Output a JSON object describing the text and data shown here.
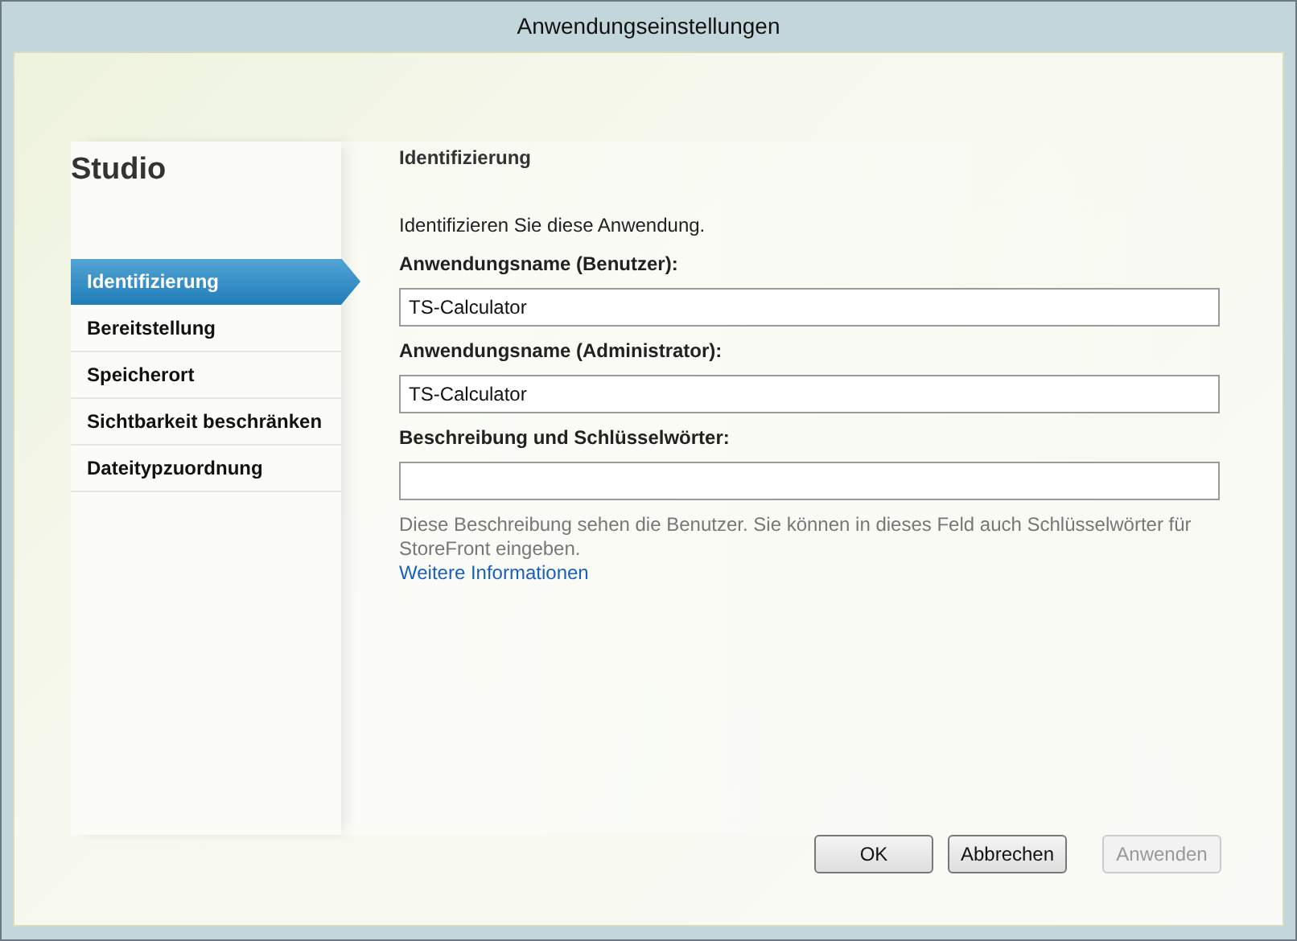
{
  "window": {
    "title": "Anwendungseinstellungen"
  },
  "sidebar": {
    "heading": "Studio",
    "items": [
      {
        "label": "Identifizierung",
        "selected": true
      },
      {
        "label": "Bereitstellung",
        "selected": false
      },
      {
        "label": "Speicherort",
        "selected": false
      },
      {
        "label": "Sichtbarkeit beschränken",
        "selected": false
      },
      {
        "label": "Dateitypzuordnung",
        "selected": false
      }
    ]
  },
  "main": {
    "heading": "Identifizierung",
    "intro": "Identifizieren Sie diese Anwendung.",
    "fields": [
      {
        "label": "Anwendungsname (Benutzer):",
        "value": "TS-Calculator"
      },
      {
        "label": "Anwendungsname (Administrator):",
        "value": "TS-Calculator"
      },
      {
        "label": "Beschreibung und Schlüsselwörter:"
      }
    ],
    "hint": "Diese Beschreibung sehen die Benutzer. Sie können in dieses Feld auch Schlüsselwörter für StoreFront eingeben.",
    "link": "Weitere Informationen"
  },
  "buttons": [
    {
      "label": "OK",
      "disabled": false
    },
    {
      "label": "Abbrechen",
      "disabled": false
    },
    {
      "label": "Anwenden",
      "disabled": true
    }
  ]
}
